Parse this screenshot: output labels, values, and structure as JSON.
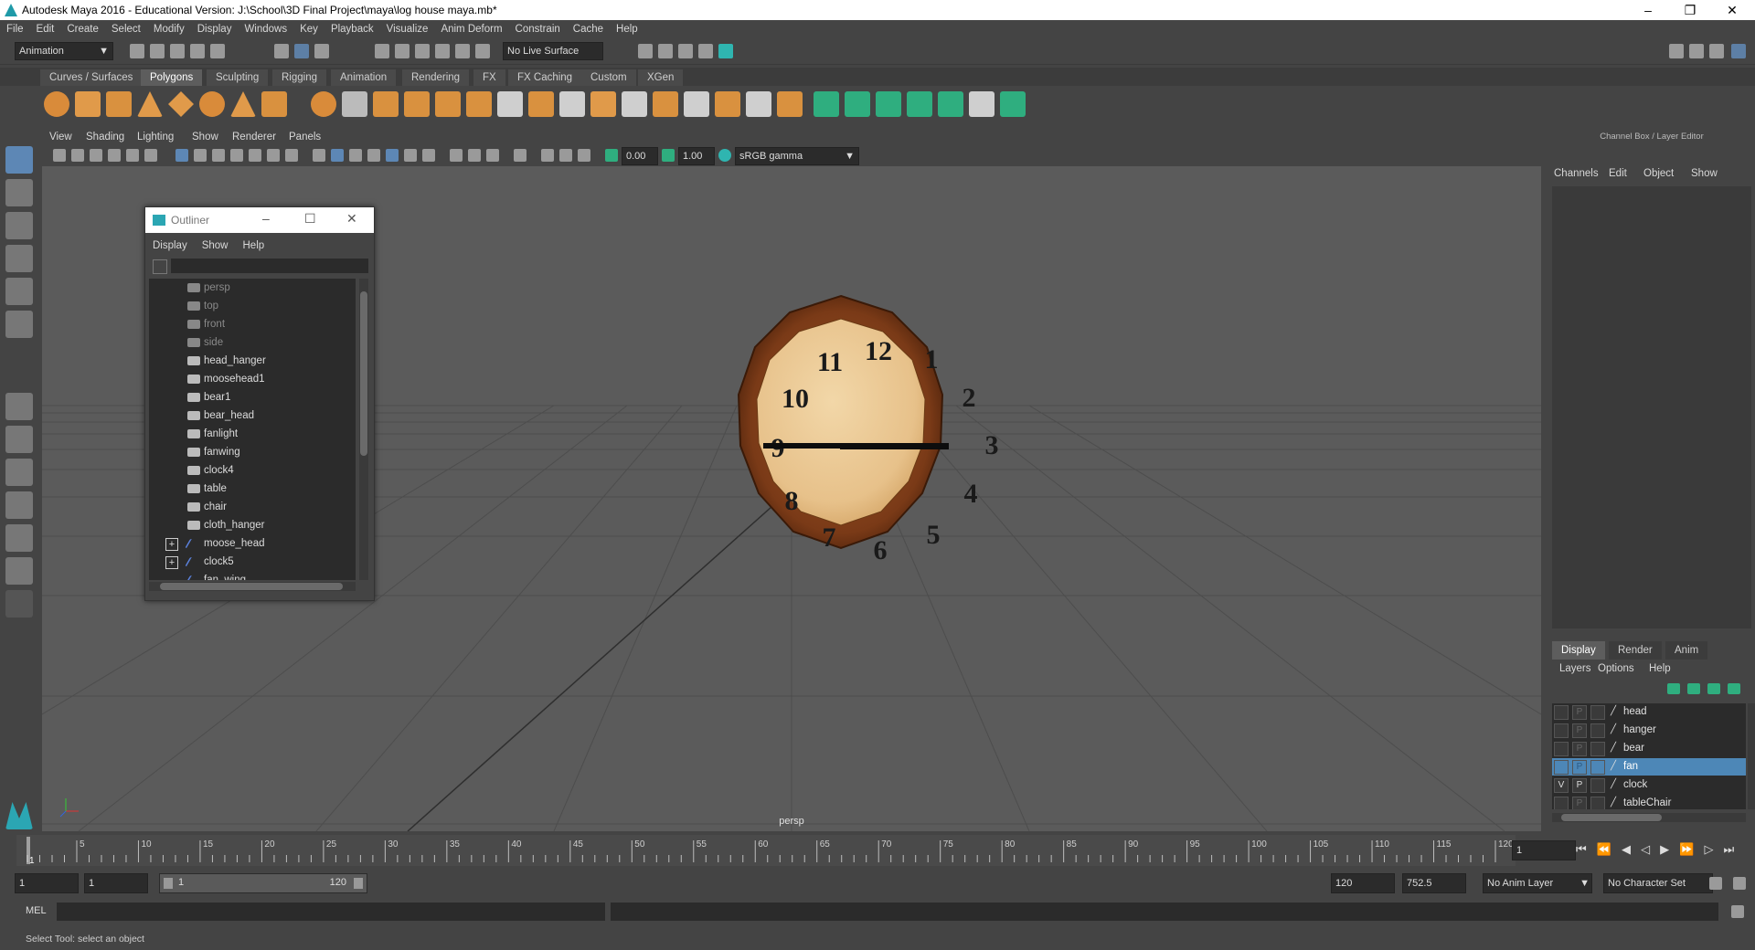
{
  "window": {
    "title": "Autodesk Maya 2016 - Educational Version: J:\\School\\3D Final Project\\maya\\log house maya.mb*",
    "controls": [
      "–",
      "❐",
      "✕"
    ]
  },
  "menubar": [
    "File",
    "Edit",
    "Create",
    "Select",
    "Modify",
    "Display",
    "Windows",
    "Key",
    "Playback",
    "Visualize",
    "Anim Deform",
    "Constrain",
    "Cache",
    "Help"
  ],
  "statusline": {
    "menuset": "Animation",
    "live_surface": "No Live Surface"
  },
  "shelf": {
    "tabs": [
      "Curves / Surfaces",
      "Polygons",
      "Sculpting",
      "Rigging",
      "Animation",
      "Rendering",
      "FX",
      "FX Caching",
      "Custom",
      "XGen"
    ],
    "active": "Polygons"
  },
  "viewport": {
    "menu": [
      "View",
      "Shading",
      "Lighting",
      "Show",
      "Renderer",
      "Panels"
    ],
    "exposure": "0.00",
    "gamma": "1.00",
    "color_space": "sRGB gamma",
    "camera_label": "persp",
    "clock_numbers": [
      "12",
      "1",
      "2",
      "3",
      "4",
      "5",
      "6",
      "7",
      "8",
      "9",
      "10",
      "11"
    ]
  },
  "outliner": {
    "title": "Outliner",
    "menu": [
      "Display",
      "Show",
      "Help"
    ],
    "items": [
      {
        "name": "persp",
        "type": "camera"
      },
      {
        "name": "top",
        "type": "camera"
      },
      {
        "name": "front",
        "type": "camera"
      },
      {
        "name": "side",
        "type": "camera"
      },
      {
        "name": "head_hanger",
        "type": "mesh"
      },
      {
        "name": "moosehead1",
        "type": "mesh"
      },
      {
        "name": "bear1",
        "type": "mesh"
      },
      {
        "name": "bear_head",
        "type": "mesh"
      },
      {
        "name": "fanlight",
        "type": "mesh"
      },
      {
        "name": "fanwing",
        "type": "mesh"
      },
      {
        "name": "clock4",
        "type": "mesh"
      },
      {
        "name": "table",
        "type": "mesh"
      },
      {
        "name": "chair",
        "type": "mesh"
      },
      {
        "name": "cloth_hanger",
        "type": "mesh"
      },
      {
        "name": "moose_head",
        "type": "group"
      },
      {
        "name": "clock5",
        "type": "group"
      },
      {
        "name": "fan_wing",
        "type": "group"
      }
    ]
  },
  "channelbox": {
    "title": "Channel Box / Layer Editor",
    "menu": [
      "Channels",
      "Edit",
      "Object",
      "Show"
    ],
    "layer_tabs": [
      "Display",
      "Render",
      "Anim"
    ],
    "layer_tab_active": "Display",
    "layer_menu": [
      "Layers",
      "Options",
      "Help"
    ],
    "layers": [
      {
        "v": "",
        "p": "P",
        "name": "head",
        "selected": false
      },
      {
        "v": "",
        "p": "P",
        "name": "hanger",
        "selected": false
      },
      {
        "v": "",
        "p": "P",
        "name": "bear",
        "selected": false
      },
      {
        "v": "",
        "p": "P",
        "name": "fan",
        "selected": true
      },
      {
        "v": "V",
        "p": "P",
        "name": "clock",
        "selected": false
      },
      {
        "v": "",
        "p": "P",
        "name": "tableChair",
        "selected": false
      }
    ]
  },
  "timeline": {
    "ticks": [
      "5",
      "10",
      "15",
      "20",
      "25",
      "30",
      "35",
      "40",
      "45",
      "50",
      "55",
      "60",
      "65",
      "70",
      "75",
      "80",
      "85",
      "90",
      "95",
      "100",
      "105",
      "110",
      "115",
      "120"
    ],
    "current_frame_label": "1",
    "current_frame": "1"
  },
  "range": {
    "start": "1",
    "playback_start": "1",
    "slider_start": "1",
    "slider_end": "120",
    "playback_end": "120",
    "end": "752.5",
    "anim_layer": "No Anim Layer",
    "character_set": "No Character Set"
  },
  "cmdline": {
    "label": "MEL"
  },
  "helpline": {
    "text": "Select Tool: select an object"
  }
}
